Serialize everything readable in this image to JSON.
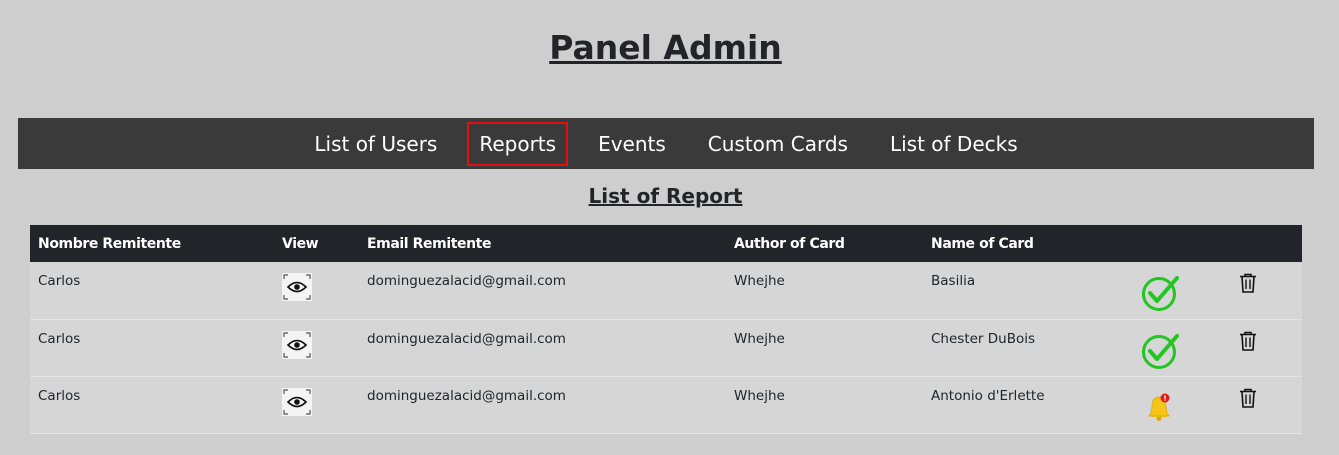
{
  "header": {
    "title": "Panel Admin"
  },
  "nav": {
    "items": [
      {
        "label": "List of Users",
        "active": false
      },
      {
        "label": "Reports",
        "active": true
      },
      {
        "label": "Events",
        "active": false
      },
      {
        "label": "Custom Cards",
        "active": false
      },
      {
        "label": "List of Decks",
        "active": false
      }
    ]
  },
  "section": {
    "title": "List of Report"
  },
  "table": {
    "columns": [
      "Nombre Remitente",
      "View",
      "Email Remitente",
      "Author of Card",
      "Name of Card",
      "",
      ""
    ],
    "rows": [
      {
        "sender": "Carlos",
        "view_icon": "eye-icon",
        "email": "dominguezalacid@gmail.com",
        "author": "Whejhe",
        "card": "Basilia",
        "status_icon": "check-icon",
        "action_icon": "trash-icon"
      },
      {
        "sender": "Carlos",
        "view_icon": "eye-icon",
        "email": "dominguezalacid@gmail.com",
        "author": "Whejhe",
        "card": "Chester DuBois",
        "status_icon": "check-icon",
        "action_icon": "trash-icon"
      },
      {
        "sender": "Carlos",
        "view_icon": "eye-icon",
        "email": "dominguezalacid@gmail.com",
        "author": "Whejhe",
        "card": "Antonio d'Erlette",
        "status_icon": "bell-notification-icon",
        "action_icon": "trash-icon"
      }
    ]
  },
  "colors": {
    "background": "#cecece",
    "navbar": "#3a3a3a",
    "table_header": "#212529",
    "active_outline": "#e01010",
    "check_green": "#22c522",
    "bell_yellow": "#f5c518"
  }
}
